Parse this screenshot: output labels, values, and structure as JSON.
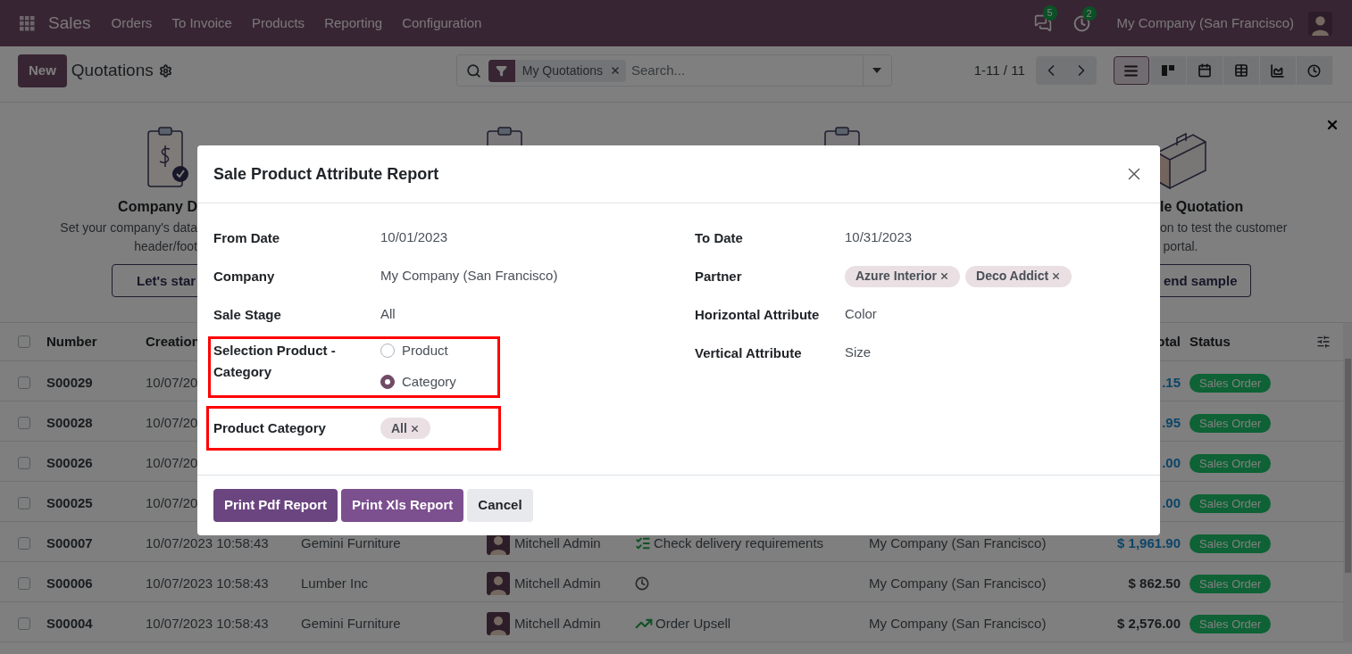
{
  "navbar": {
    "app_name": "Sales",
    "menu": [
      "Orders",
      "To Invoice",
      "Products",
      "Reporting",
      "Configuration"
    ],
    "messages_count": "5",
    "activities_count": "2",
    "company": "My Company (San Francisco)"
  },
  "control_panel": {
    "new_button": "New",
    "title": "Quotations",
    "search": {
      "facet": "My Quotations",
      "placeholder": "Search..."
    },
    "pager": "1-11 / 11",
    "views": [
      {
        "kind": "list",
        "selected": true
      },
      {
        "kind": "kanban",
        "selected": false
      },
      {
        "kind": "calendar",
        "selected": false
      },
      {
        "kind": "pivot",
        "selected": false
      },
      {
        "kind": "graph",
        "selected": false
      },
      {
        "kind": "activity",
        "selected": false
      }
    ]
  },
  "onboarding": {
    "steps": [
      {
        "kind": "invoice",
        "title": "Company D",
        "lines": [
          "Set your company's data",
          "header/foot"
        ],
        "button": "Let's star"
      },
      {
        "kind": "clipboard"
      },
      {
        "kind": "clipboard"
      },
      {
        "kind": "briefcase",
        "title": "le Quotation",
        "lines": [
          "on to test the customer",
          "portal."
        ],
        "button": "end sample"
      }
    ]
  },
  "table": {
    "all_checked": false,
    "columns": [
      {
        "kind": "number",
        "label": "Number"
      },
      {
        "kind": "creation",
        "label": "Creation"
      },
      {
        "kind": "total",
        "label": "otal"
      },
      {
        "kind": "status",
        "label": "Status"
      }
    ],
    "rows": [
      {
        "checked": false,
        "number": "S00029",
        "creation": "10/07/20",
        "total": ".15",
        "total_highlighted": true,
        "status": "Sales Order"
      },
      {
        "checked": false,
        "number": "S00028",
        "creation": "10/07/20",
        "total": ".95",
        "total_highlighted": true,
        "status": "Sales Order"
      },
      {
        "checked": false,
        "number": "S00026",
        "creation": "10/07/20",
        "total": ".00",
        "total_highlighted": true,
        "status": "Sales Order"
      },
      {
        "checked": false,
        "number": "S00025",
        "creation": "10/07/20",
        "total": ".00",
        "total_highlighted": true,
        "status": "Sales Order"
      },
      {
        "checked": false,
        "number": "S00007",
        "creation": "10/07/2023 10:58:43",
        "customer": "Gemini Furniture",
        "salesperson": "Mitchell Admin",
        "activity": {
          "kind": "todo",
          "text": "Check delivery requirements"
        },
        "company": "My Company (San Francisco)",
        "total": "$ 1,961.90",
        "total_highlighted": true,
        "status": "Sales Order"
      },
      {
        "checked": false,
        "number": "S00006",
        "creation": "10/07/2023 10:58:43",
        "customer": "Lumber Inc",
        "salesperson": "Mitchell Admin",
        "activity": {
          "kind": "clock"
        },
        "company": "My Company (San Francisco)",
        "total": "$ 862.50",
        "total_highlighted": false,
        "status": "Sales Order"
      },
      {
        "checked": false,
        "number": "S00004",
        "creation": "10/07/2023 10:58:43",
        "customer": "Gemini Furniture",
        "salesperson": "Mitchell Admin",
        "activity": {
          "kind": "upsell",
          "text": "Order Upsell"
        },
        "company": "My Company (San Francisco)",
        "total": "$ 2,576.00",
        "total_highlighted": false,
        "status": "Sales Order"
      }
    ]
  },
  "dialog": {
    "title": "Sale Product Attribute Report",
    "left_fields": [
      {
        "kind": "text",
        "label": "From Date",
        "value": "10/01/2023",
        "highlighted": false
      },
      {
        "kind": "text",
        "label": "Company",
        "value": "My Company (San Francisco)",
        "highlighted": false
      },
      {
        "kind": "text",
        "label": "Sale Stage",
        "value": "All",
        "highlighted": false
      },
      {
        "kind": "radio",
        "label": "Selection Product - Category",
        "options": [
          {
            "label": "Product",
            "selected": false
          },
          {
            "label": "Category",
            "selected": true
          }
        ],
        "highlighted": true
      },
      {
        "kind": "tags",
        "label": "Product Category",
        "tags": [
          "All"
        ],
        "highlighted": true
      }
    ],
    "right_fields": [
      {
        "kind": "text",
        "label": "To Date",
        "value": "10/31/2023",
        "highlighted": false
      },
      {
        "kind": "tags",
        "label": "Partner",
        "tags": [
          "Azure Interior",
          "Deco Addict"
        ],
        "highlighted": false
      },
      {
        "kind": "text",
        "label": "Horizontal Attribute",
        "value": "Color",
        "highlighted": false
      },
      {
        "kind": "text",
        "label": "Vertical Attribute",
        "value": "Size",
        "highlighted": false
      }
    ],
    "buttons": [
      {
        "kind": "primary",
        "label": "Print Pdf Report",
        "hovered": true
      },
      {
        "kind": "primary",
        "label": "Print Xls Report",
        "hovered": false
      },
      {
        "kind": "secondary",
        "label": "Cancel",
        "hovered": false
      }
    ]
  }
}
